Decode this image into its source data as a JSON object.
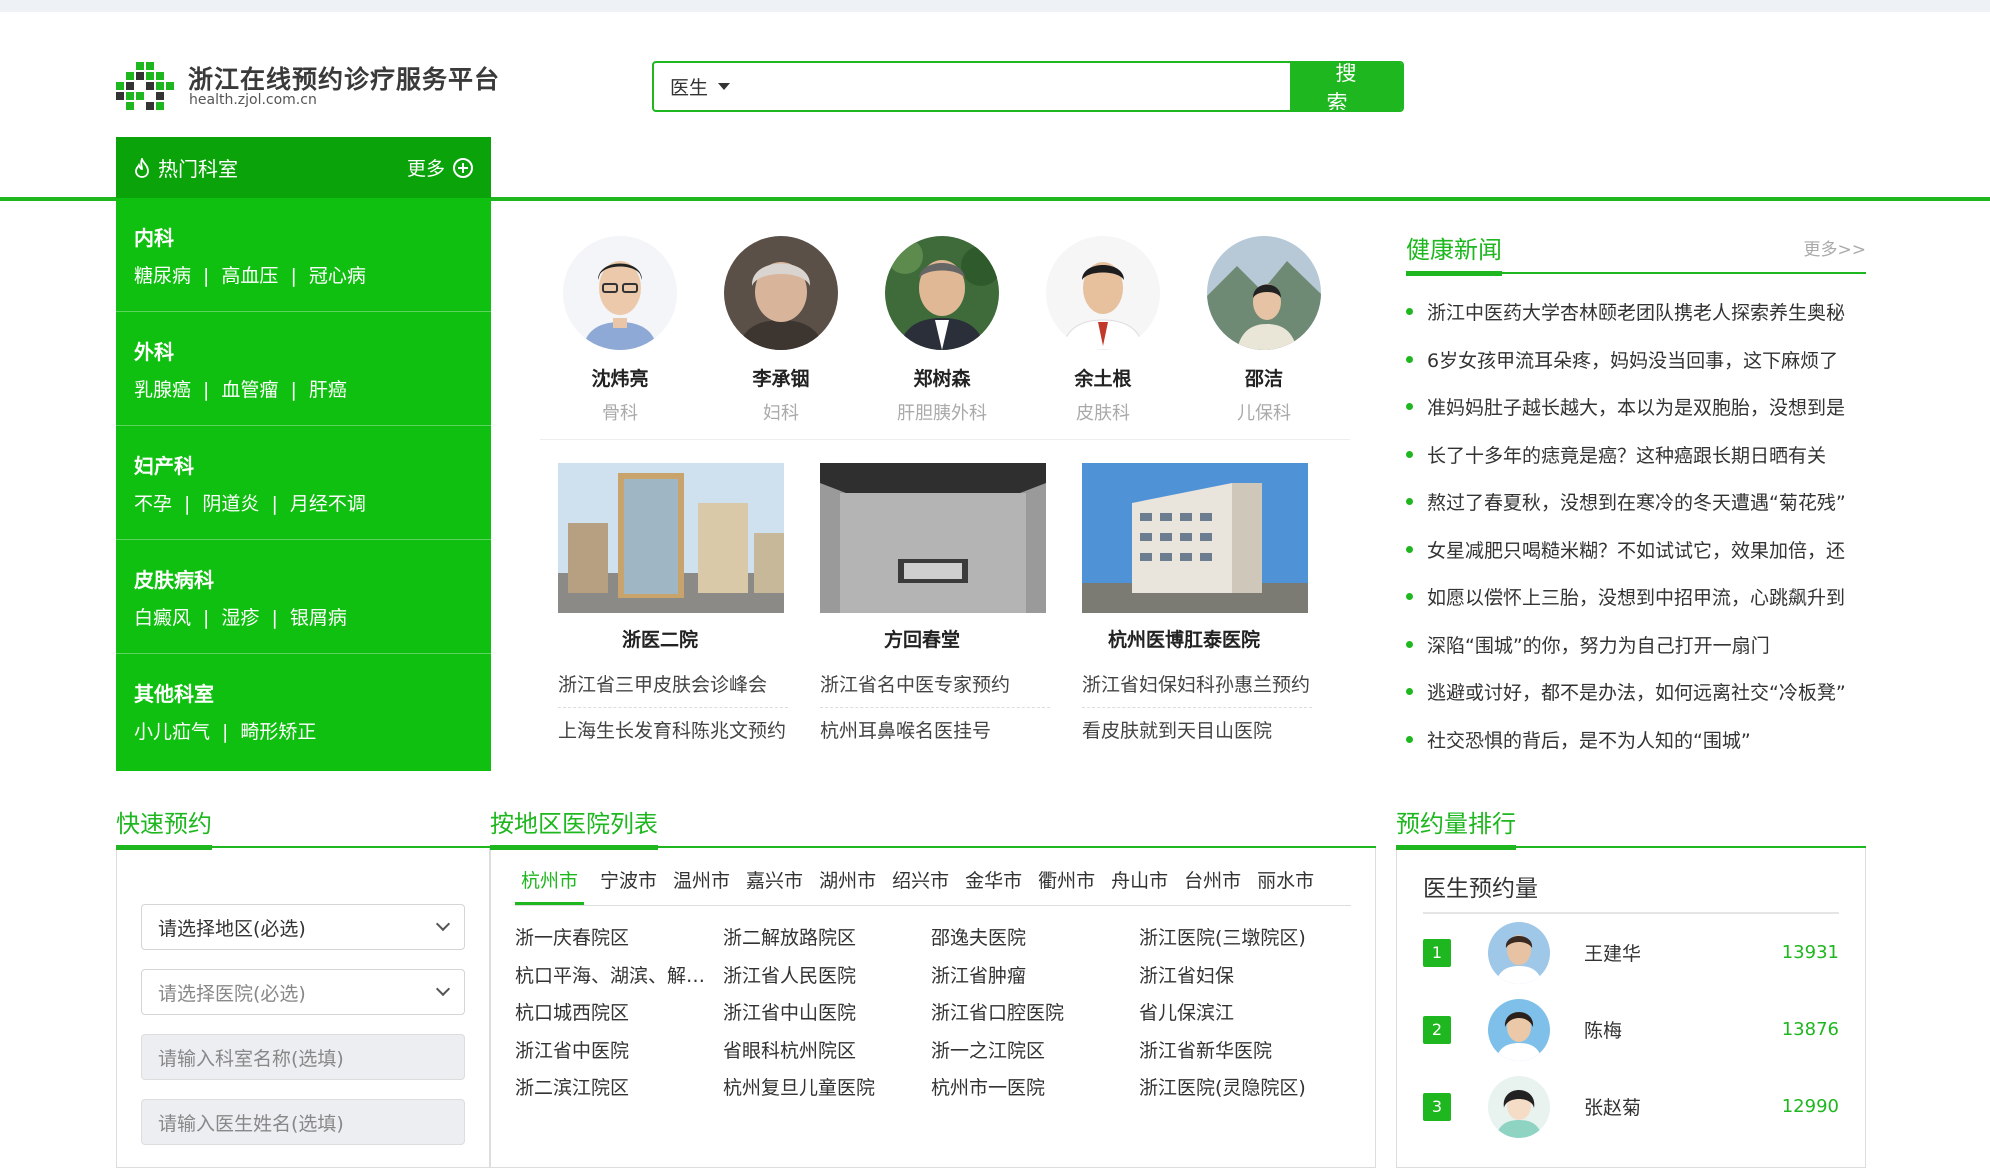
{
  "brand": {
    "title": "浙江在线预约诊疗服务平台",
    "url": "health.zjol.com.cn",
    "colors": {
      "primary": "#1fb71f",
      "sidebar": "#10c010"
    }
  },
  "search": {
    "type_selected": "医生",
    "placeholder": "",
    "button_label": "搜 索"
  },
  "sidebar": {
    "title": "热门科室",
    "more_label": "更多",
    "categories": [
      {
        "name": "内科",
        "links": [
          "糖尿病",
          "高血压",
          "冠心病"
        ]
      },
      {
        "name": "外科",
        "links": [
          "乳腺癌",
          "血管瘤",
          "肝癌"
        ]
      },
      {
        "name": "妇产科",
        "links": [
          "不孕",
          "阴道炎",
          "月经不调"
        ]
      },
      {
        "name": "皮肤病科",
        "links": [
          "白癜风",
          "湿疹",
          "银屑病"
        ]
      },
      {
        "name": "其他科室",
        "links": [
          "小儿疝气",
          "畸形矫正"
        ]
      }
    ]
  },
  "doctors": [
    {
      "name": "沈炜亮",
      "dept": "骨科"
    },
    {
      "name": "李承铟",
      "dept": "妇科"
    },
    {
      "name": "郑树森",
      "dept": "肝胆胰外科"
    },
    {
      "name": "余土根",
      "dept": "皮肤科"
    },
    {
      "name": "邵洁",
      "dept": "儿保科"
    }
  ],
  "hospitals": [
    {
      "name": "浙医二院",
      "links": [
        "浙江省三甲皮肤会诊峰会",
        "上海生长发育科陈兆文预约"
      ]
    },
    {
      "name": "方回春堂",
      "links": [
        "浙江省名中医专家预约",
        "杭州耳鼻喉名医挂号"
      ]
    },
    {
      "name": "杭州医博肛泰医院",
      "links": [
        "浙江省妇保妇科孙惠兰预约",
        "看皮肤就到天目山医院"
      ]
    }
  ],
  "news": {
    "title": "健康新闻",
    "more_label": "更多>>",
    "items": [
      "浙江中医药大学杏林颐老团队携老人探索养生奥秘",
      "6岁女孩甲流耳朵疼，妈妈没当回事，这下麻烦了",
      "准妈妈肚子越长越大，本以为是双胞胎，没想到是",
      "长了十多年的痣竟是癌？这种癌跟长期日晒有关",
      "熬过了春夏秋，没想到在寒冷的冬天遭遇“菊花残”",
      "女星减肥只喝糙米糊？不如试试它，效果加倍，还",
      "如愿以偿怀上三胎，没想到中招甲流，心跳飙升到",
      "深陷“围城”的你，努力为自己打开一扇门",
      "逃避或讨好，都不是办法，如何远离社交“冷板凳”",
      "社交恐惧的背后，是不为人知的“围城”"
    ]
  },
  "quick": {
    "title": "快速预约",
    "region_select": "请选择地区(必选)",
    "hospital_select": "请选择医院(必选)",
    "dept_placeholder": "请输入科室名称(选填)",
    "doctor_placeholder": "请输入医生姓名(选填)"
  },
  "region": {
    "title": "按地区医院列表",
    "cities": [
      "杭州市",
      "宁波市",
      "温州市",
      "嘉兴市",
      "湖州市",
      "绍兴市",
      "金华市",
      "衢州市",
      "舟山市",
      "台州市",
      "丽水市"
    ],
    "active_city": "杭州市",
    "hospitals": [
      "浙一庆春院区",
      "浙二解放路院区",
      "邵逸夫医院",
      "浙江医院(三墩院区)",
      "杭口平海、湖滨、解放路院区",
      "浙江省人民医院",
      "浙江省肿瘤",
      "浙江省妇保",
      "杭口城西院区",
      "浙江省中山医院",
      "浙江省口腔医院",
      "省儿保滨江",
      "浙江省中医院",
      "省眼科杭州院区",
      "浙一之江院区",
      "浙江省新华医院",
      "浙二滨江院区",
      "杭州复旦儿童医院",
      "杭州市一医院",
      "浙江医院(灵隐院区)"
    ]
  },
  "rank": {
    "title": "预约量排行",
    "subtitle": "医生预约量",
    "rows": [
      {
        "num": "1",
        "name": "王建华",
        "count": "13931"
      },
      {
        "num": "2",
        "name": "陈梅",
        "count": "13876"
      },
      {
        "num": "3",
        "name": "张赵菊",
        "count": "12990"
      }
    ]
  }
}
